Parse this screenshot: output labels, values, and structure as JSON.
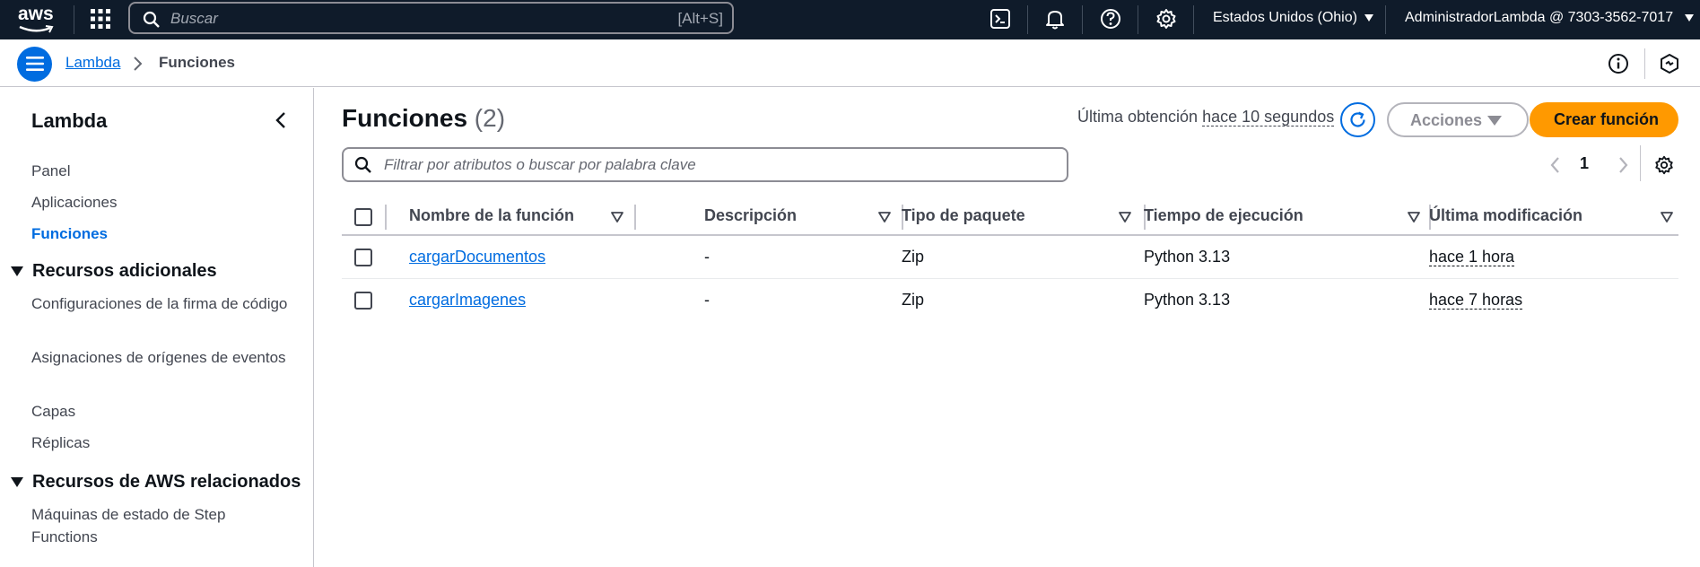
{
  "topnav": {
    "logo_text": "aws",
    "search_placeholder": "Buscar",
    "search_shortcut": "[Alt+S]",
    "region": "Estados Unidos (Ohio)",
    "account": "AdministradorLambda @ 7303-3562-7017",
    "icons": [
      "cloudshell-icon",
      "bell-icon",
      "help-icon",
      "gear-icon"
    ]
  },
  "breadcrumb": {
    "link": "Lambda",
    "current": "Funciones"
  },
  "sidebar": {
    "title": "Lambda",
    "items": [
      {
        "label": "Panel",
        "active": false
      },
      {
        "label": "Aplicaciones",
        "active": false
      },
      {
        "label": "Funciones",
        "active": true
      }
    ],
    "section1": {
      "title": "Recursos adicionales",
      "items": [
        "Configuraciones de la firma de código",
        "Asignaciones de orígenes de eventos",
        "Capas",
        "Réplicas"
      ]
    },
    "section2": {
      "title": "Recursos de AWS relacionados",
      "items": [
        "Máquinas de estado de Step Functions"
      ]
    }
  },
  "main": {
    "title": "Funciones",
    "count": "(2)",
    "last_fetch_label": "Última obtención",
    "last_fetch_ago": "hace 10 segundos",
    "actions_label": "Acciones",
    "create_label": "Crear función",
    "filter_placeholder": "Filtrar por atributos o buscar por palabra clave",
    "page": "1"
  },
  "table": {
    "columns": [
      "Nombre de la función",
      "Descripción",
      "Tipo de paquete",
      "Tiempo de ejecución",
      "Última modificación"
    ],
    "rows": [
      {
        "name": "cargarDocumentos",
        "description": "-",
        "package": "Zip",
        "runtime": "Python 3.13",
        "modified": "hace 1 hora"
      },
      {
        "name": "cargarImagenes",
        "description": "-",
        "package": "Zip",
        "runtime": "Python 3.13",
        "modified": "hace 7 horas"
      }
    ]
  },
  "colors": {
    "nav_bg": "#0f1b2a",
    "link": "#006ce0",
    "primary_button": "#ff9900"
  }
}
